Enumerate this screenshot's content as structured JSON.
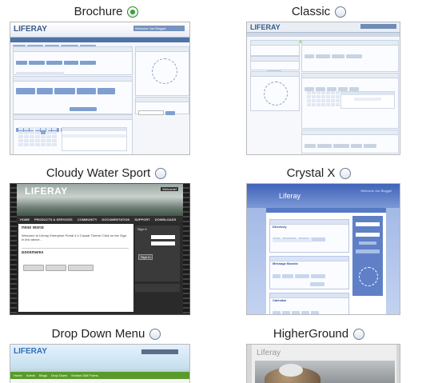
{
  "themes": [
    {
      "name": "Brochure",
      "selected": true
    },
    {
      "name": "Classic",
      "selected": false
    },
    {
      "name": "Cloudy Water Sport",
      "selected": false
    },
    {
      "name": "Crystal X",
      "selected": false
    },
    {
      "name": "Drop Down Menu",
      "selected": false
    },
    {
      "name": "HigherGround",
      "selected": false
    }
  ],
  "thumbs": {
    "brochure": {
      "logo": "LIFERAY",
      "welcome": "Welcome Joe Bloggs!"
    },
    "classic": {
      "logo": "LIFERAY"
    },
    "cloudy": {
      "logo": "LIFERAY",
      "welcome": "Welcome!",
      "nav": [
        "HOME",
        "PRODUCTS & SERVICES",
        "COMMUNITY",
        "DOCUMENTATION",
        "SUPPORT",
        "DOWNLOADS",
        "LIBRARY"
      ],
      "hello": "Hello World",
      "hello_text": "Welcome to Liferay Enterprise Portal 4.4 Crystal Theme! Click on the Sign In link above...",
      "bookmarks": "Bookmarks",
      "sign_in": "Sign In",
      "sign_in_btn": "Sign In"
    },
    "crystal": {
      "logo": "Liferay",
      "welcome": "Welcome Joe Bloggs!",
      "sections": [
        "Directory",
        "Message Boards",
        "Calendar"
      ]
    },
    "dropdown": {
      "logo": "LIFERAY",
      "nav": [
        "Home",
        "Admin",
        "Blogs",
        "Drop Down",
        "Section 508 Forms"
      ]
    },
    "higher": {
      "logo": "Liferay"
    }
  },
  "colors": {
    "selected_radio": "#3aa12e",
    "brochure_blue": "#6d8fbf",
    "crystal_blue": "#3f63b8",
    "dropdown_green": "#5a9a2c",
    "cloudy_dark": "#2f2f2f"
  }
}
